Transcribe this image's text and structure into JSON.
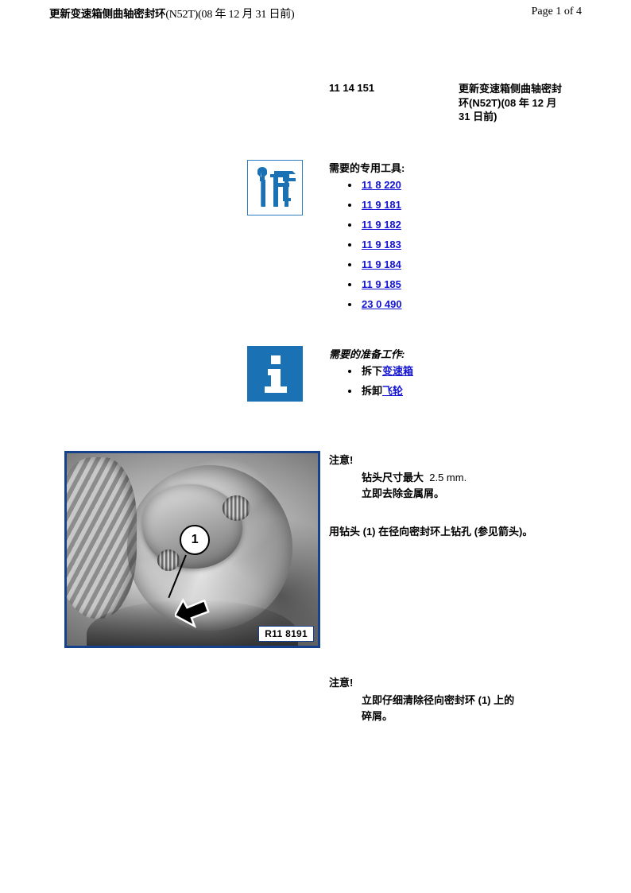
{
  "header": {
    "title_cjk": "更新变速箱侧曲轴密封环",
    "title_latin": "(N52T)(08 年  12 月  31 日前)",
    "page_indicator": "Page 1 of 4"
  },
  "title_block": {
    "number": "11 14 151",
    "title": "更新变速箱侧曲轴密封环(N52T)(08 年 12 月 31 日前)"
  },
  "tools_section": {
    "icon": "wrench-caliper-icon",
    "heading": "需要的专用工具:",
    "items": [
      {
        "label": "11 8 220"
      },
      {
        "label": "11 9 181"
      },
      {
        "label": "11 9 182"
      },
      {
        "label": "11 9 183"
      },
      {
        "label": "11 9 184"
      },
      {
        "label": "11 9 185"
      },
      {
        "label": "23 0 490"
      }
    ]
  },
  "prep_section": {
    "icon": "information-icon",
    "heading": "需要的准备工作:",
    "items": [
      {
        "prefix": "拆下",
        "link": "变速箱"
      },
      {
        "prefix": "拆卸",
        "link": "飞轮"
      }
    ]
  },
  "figure": {
    "callout_number": "1",
    "label": "R11 8191"
  },
  "note_1": {
    "title": "注意!",
    "line_1_text": "钻头尺寸最大",
    "line_1_value": "2.5 mm.",
    "line_2": "立即去除金属屑。"
  },
  "instruction_1": {
    "text": "用钻头 (1) 在径向密封环上钻孔 (参见箭头)。"
  },
  "note_2": {
    "title": "注意!",
    "line_1": "立即仔细清除径向密封环 (1) 上的",
    "line_2": "碎屑。"
  },
  "colors": {
    "link": "#1414d2",
    "icon_blue": "#1a72b5",
    "figure_border": "#16418c"
  }
}
